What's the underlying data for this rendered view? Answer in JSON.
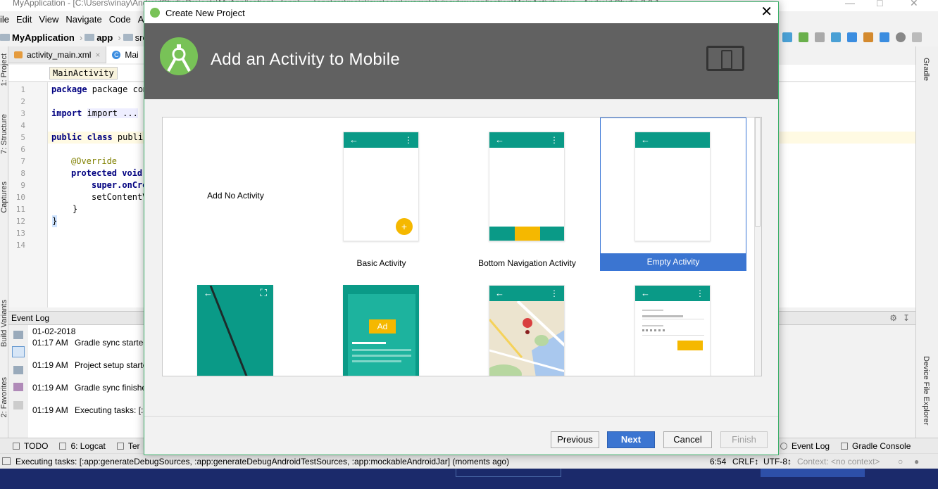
{
  "ide": {
    "title": "MyApplication - [C:\\Users\\vinay\\AndroidStudioProjects\\MyApplication] - [app] - ...\\app\\src\\main\\java\\com\\example\\vinay\\myapplication\\MainActivity.java - Android Studio 3.0.1",
    "menu": {
      "file": "ile",
      "edit": "Edit",
      "view": "View",
      "navigate": "Navigate",
      "code": "Code",
      "analyze": "A"
    },
    "breadcrumb": {
      "project": "MyApplication",
      "app": "app",
      "src": "src"
    },
    "tabs": {
      "xml": "activity_main.xml",
      "java": "Mai"
    },
    "crumb_chip": "MainActivity",
    "code": {
      "line_numbers": [
        "1",
        "2",
        "3",
        "4",
        "5",
        "6",
        "7",
        "8",
        "9",
        "10",
        "11",
        "12",
        "13",
        "14"
      ],
      "l1": "package com.example",
      "l3": "import ...",
      "l6": "public class MainAc",
      "l8": "@Override",
      "l9": "protected void",
      "l10": "super.onCre",
      "l11": "setContentV",
      "l12": "}",
      "l13": "}"
    },
    "side_left_labels": {
      "project": "1: Project",
      "structure": "7: Structure",
      "captures": "Captures",
      "build_variants": "Build Variants",
      "favorites": "2: Favorites"
    },
    "side_right_labels": {
      "gradle": "Gradle",
      "device_file_explorer": "Device File Explorer"
    },
    "event_log": {
      "title": "Event Log",
      "date": "01-02-2018",
      "rows": [
        {
          "time": "01:17 AM",
          "message": "Gradle sync started"
        },
        {
          "time": "01:19 AM",
          "message": "Project setup starte"
        },
        {
          "time": "01:19 AM",
          "message": "Gradle sync finishe"
        },
        {
          "time": "01:19 AM",
          "message": "Executing tasks: [:a"
        }
      ]
    },
    "bottom_tools": {
      "todo": "TODO",
      "logcat": "6: Logcat",
      "terminal": "Ter",
      "event_log": "Event Log",
      "gradle_console": "Gradle Console"
    },
    "status": {
      "message": "Executing tasks: [:app:generateDebugSources, :app:generateDebugAndroidTestSources, :app:mockableAndroidJar] (moments ago)",
      "position": "6:54",
      "line_sep": "CRLF↕",
      "encoding": "UTF-8↕",
      "context": "Context: <no context>"
    }
  },
  "dialog": {
    "title": "Create New Project",
    "close_glyph": "✕",
    "heading": "Add an Activity to Mobile",
    "templates": [
      {
        "label": "Add No Activity",
        "kind": "none"
      },
      {
        "label": "Basic Activity",
        "kind": "basic"
      },
      {
        "label": "Bottom Navigation Activity",
        "kind": "bottom_nav"
      },
      {
        "label": "Empty Activity",
        "kind": "empty",
        "selected": true
      },
      {
        "label": "",
        "kind": "fullscreen"
      },
      {
        "label": "",
        "kind": "ad"
      },
      {
        "label": "",
        "kind": "maps"
      },
      {
        "label": "",
        "kind": "login"
      }
    ],
    "ad_badge": "Ad",
    "buttons": {
      "previous": "Previous",
      "next": "Next",
      "cancel": "Cancel",
      "finish": "Finish"
    }
  },
  "colors": {
    "teal": "#0a9a87",
    "amber": "#f5b800",
    "selection": "#3b75d1",
    "header": "#616161"
  }
}
